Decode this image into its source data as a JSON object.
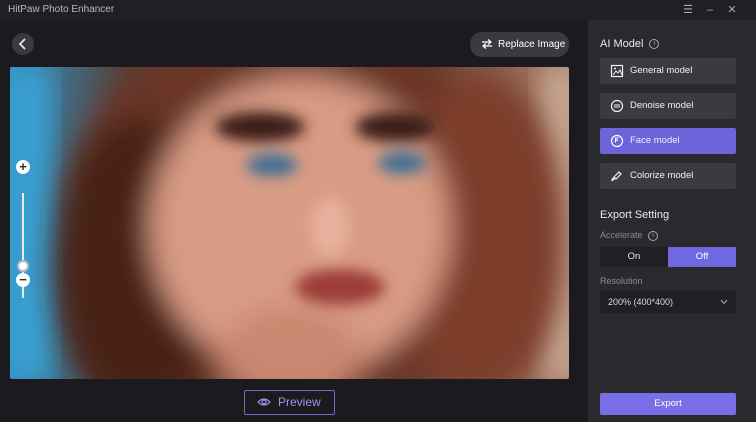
{
  "window": {
    "title": "HitPaw Photo Enhancer",
    "controls": [
      "menu-icon",
      "minimize-icon",
      "close-icon"
    ]
  },
  "toolbar": {
    "back_icon": "chevron-left-icon",
    "replace_label": "Replace Image"
  },
  "canvas": {
    "zoom_plus": "+",
    "zoom_minus": "−"
  },
  "preview_label": "Preview",
  "sidebar": {
    "ai_model_title": "AI Model",
    "info_symbol": "i",
    "models": [
      {
        "label": "General model",
        "icon": "image-icon",
        "selected": false
      },
      {
        "label": "Denoise model",
        "icon": "denoise-icon",
        "selected": false
      },
      {
        "label": "Face model",
        "icon": "face-icon",
        "selected": true
      },
      {
        "label": "Colorize model",
        "icon": "brush-icon",
        "selected": false
      }
    ],
    "export_setting_title": "Export Setting",
    "accelerate_label": "Accelerate",
    "accelerate_on": "On",
    "accelerate_off": "Off",
    "accelerate_value": "Off",
    "resolution_label": "Resolution",
    "resolution_value": "200% (400*400)",
    "export_label": "Export"
  },
  "colors": {
    "accent": "#7a6ee8",
    "selected_model": "#6c64d8",
    "preview_border": "#6f6bc8"
  }
}
